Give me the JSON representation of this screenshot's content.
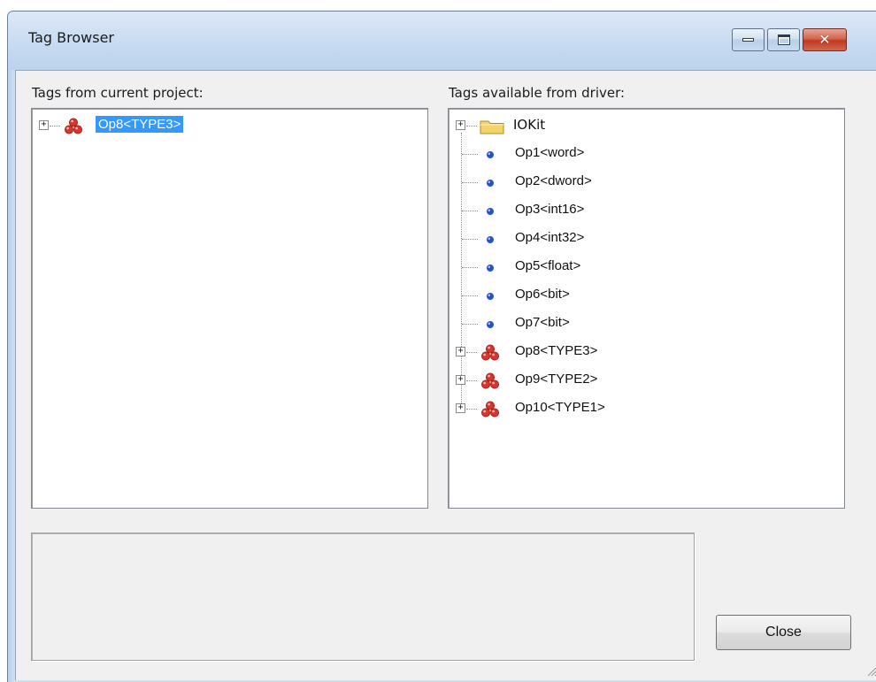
{
  "window": {
    "title": "Tag Browser",
    "controls": {
      "minimize": "minimize",
      "maximize": "maximize",
      "close": "close"
    }
  },
  "left_panel": {
    "label": "Tags from current project:",
    "items": [
      {
        "label": "Op8<TYPE3>",
        "icon": "struct-icon",
        "expandable": true,
        "selected": true
      }
    ]
  },
  "right_panel": {
    "label": "Tags available from driver:",
    "items": [
      {
        "label": "IOKit",
        "icon": "folder-icon",
        "expandable": true
      },
      {
        "label": "Op1<word>",
        "icon": "tag-dot-icon",
        "expandable": false
      },
      {
        "label": "Op2<dword>",
        "icon": "tag-dot-icon",
        "expandable": false
      },
      {
        "label": "Op3<int16>",
        "icon": "tag-dot-icon",
        "expandable": false
      },
      {
        "label": "Op4<int32>",
        "icon": "tag-dot-icon",
        "expandable": false
      },
      {
        "label": "Op5<float>",
        "icon": "tag-dot-icon",
        "expandable": false
      },
      {
        "label": "Op6<bit>",
        "icon": "tag-dot-icon",
        "expandable": false
      },
      {
        "label": "Op7<bit>",
        "icon": "tag-dot-icon",
        "expandable": false
      },
      {
        "label": "Op8<TYPE3>",
        "icon": "struct-icon",
        "expandable": true
      },
      {
        "label": "Op9<TYPE2>",
        "icon": "struct-icon",
        "expandable": true
      },
      {
        "label": "Op10<TYPE1>",
        "icon": "struct-icon",
        "expandable": true
      }
    ]
  },
  "description_box": {
    "text": ""
  },
  "buttons": {
    "close_label": "Close"
  },
  "colors": {
    "selection": "#3399ff",
    "struct_icon": "#d9342b",
    "tag_dot": "#2a4fc9",
    "folder": "#f3d36b"
  }
}
